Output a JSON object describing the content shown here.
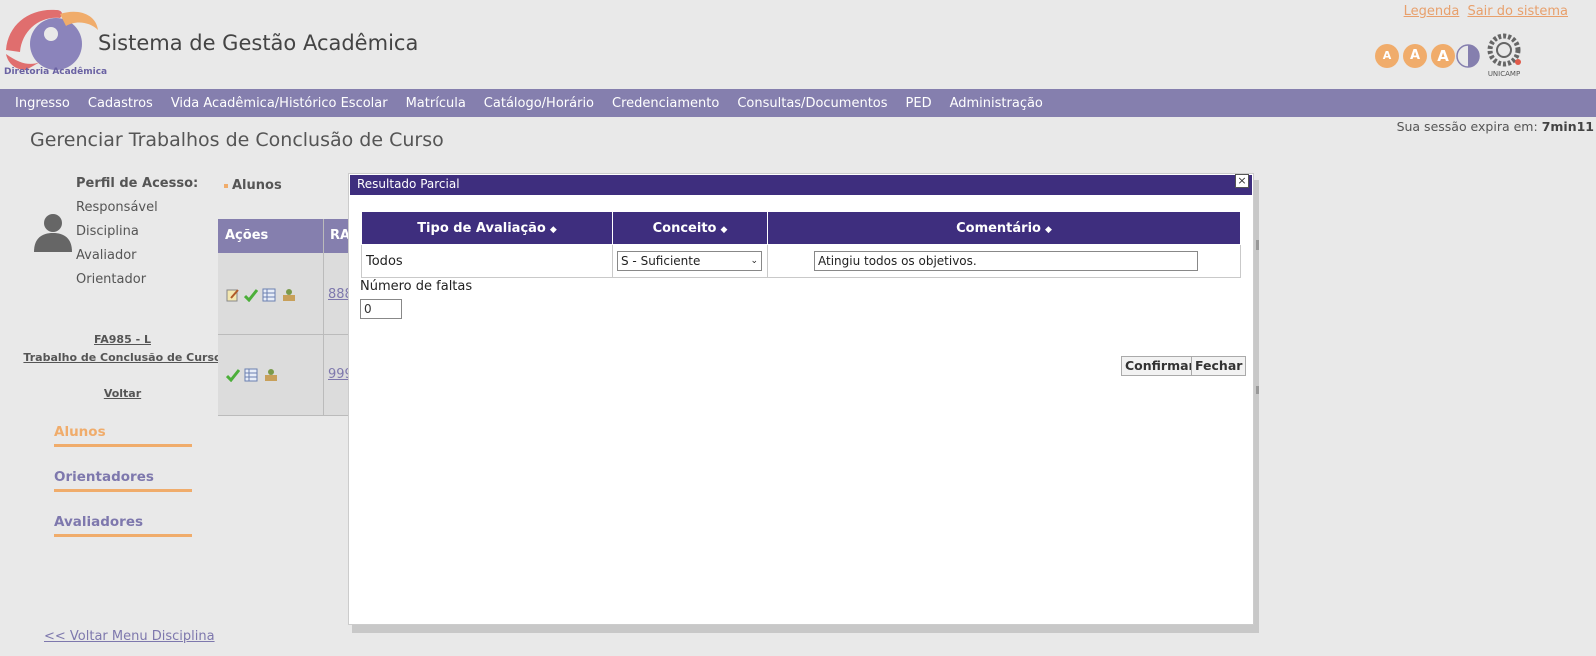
{
  "header": {
    "title": "Sistema de Gestão Acadêmica",
    "logo_caption": "Diretoria Acadêmica",
    "link_legenda": "Legenda",
    "link_sair": "Sair do sistema",
    "accessibility": [
      "A",
      "A",
      "A"
    ],
    "unicamp_label": "UNICAMP"
  },
  "nav": [
    "Ingresso",
    "Cadastros",
    "Vida Acadêmica/Histórico Escolar",
    "Matrícula",
    "Catálogo/Horário",
    "Credenciamento",
    "Consultas/Documentos",
    "PED",
    "Administração"
  ],
  "session": {
    "label": "Sua sessão expira em:",
    "time": "7min11"
  },
  "page_title": "Gerenciar Trabalhos de Conclusão de Curso",
  "profile": {
    "label": "Perfil de Acesso:",
    "items": [
      "Responsável",
      "Disciplina",
      "Avaliador",
      "Orientador"
    ]
  },
  "course": {
    "code": "FA985 - L",
    "name": "Trabalho de Conclusão de Curso",
    "back": "Voltar"
  },
  "side_tabs": [
    "Alunos",
    "Orientadores",
    "Avaliadores"
  ],
  "back_menu": "<< Voltar Menu Disciplina",
  "background_table": {
    "heading": "Alunos",
    "columns": [
      "Ações",
      "RA"
    ],
    "ra": [
      "888",
      "999"
    ]
  },
  "modal": {
    "title": "Resultado Parcial",
    "close": "×",
    "columns": [
      "Tipo de Avaliação",
      "Conceito",
      "Comentário"
    ],
    "row": {
      "tipo": "Todos",
      "conceito": "S - Suficiente",
      "comentario": "Atingiu todos os objetivos."
    },
    "faltas_label": "Número de faltas",
    "faltas_value": "0",
    "btn_confirmar": "Confirmar",
    "btn_fechar": "Fechar"
  },
  "colors": {
    "nav": "#857fae",
    "modal_header": "#3e2e7e",
    "accent": "#f0ac6b"
  }
}
